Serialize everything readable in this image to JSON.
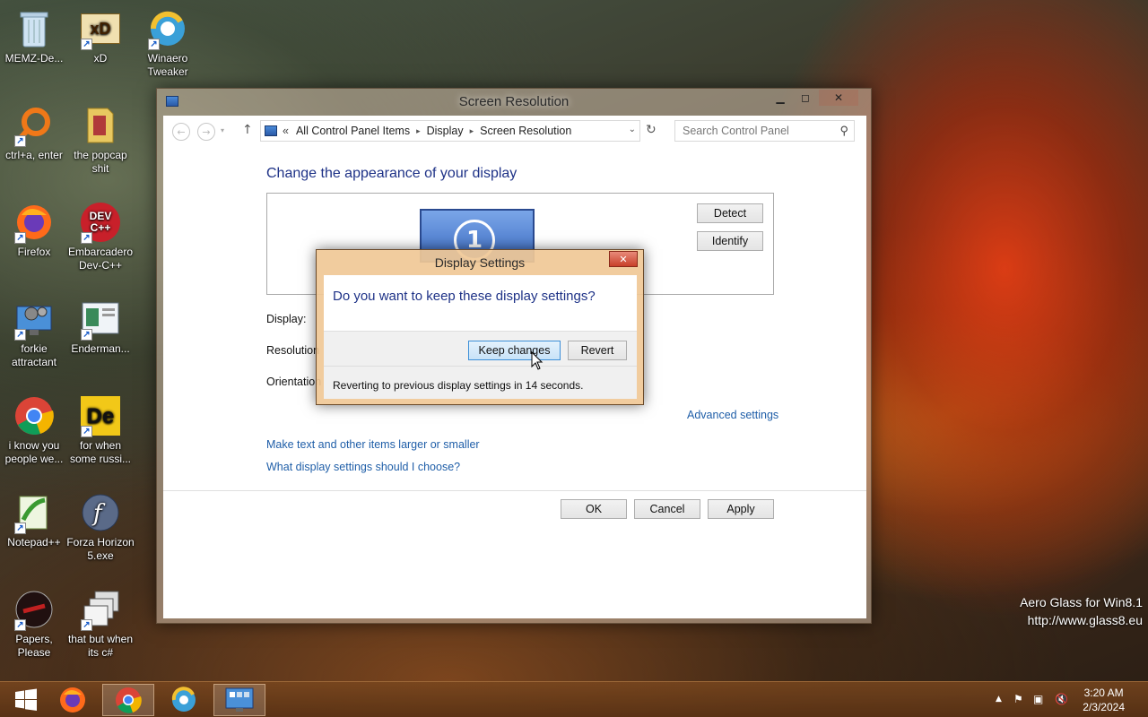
{
  "desktop": {
    "icons": [
      {
        "label": "MEMZ-De..."
      },
      {
        "label": "xD"
      },
      {
        "label": "Winaero Tweaker"
      },
      {
        "label": "ctrl+a, enter"
      },
      {
        "label": "the popcap shit"
      },
      {
        "label": "Firefox"
      },
      {
        "label": "Embarcadero Dev-C++"
      },
      {
        "label": "forkie attractant"
      },
      {
        "label": "Enderman..."
      },
      {
        "label": "i know you people we..."
      },
      {
        "label": "for when some russi..."
      },
      {
        "label": "Notepad++"
      },
      {
        "label": "Forza Horizon 5.exe"
      },
      {
        "label": "Papers, Please"
      },
      {
        "label": "that but when its c#"
      }
    ],
    "icon_glyphs": {
      "dev": "DEV C++",
      "de": "De",
      "xd": "xD"
    }
  },
  "window": {
    "title": "Screen Resolution",
    "breadcrumb": {
      "chevrons": "«",
      "items": [
        "All Control Panel Items",
        "Display",
        "Screen Resolution"
      ],
      "separator": "▸"
    },
    "search_placeholder": "Search Control Panel",
    "heading": "Change the appearance of your display",
    "monitor_number": "1",
    "buttons": {
      "detect": "Detect",
      "identify": "Identify",
      "ok": "OK",
      "cancel": "Cancel",
      "apply": "Apply"
    },
    "labels": {
      "display": "Display:",
      "resolution": "Resolution",
      "orientation": "Orientation"
    },
    "links": {
      "advanced": "Advanced settings",
      "text_size": "Make text and other items larger or smaller",
      "which_settings": "What display settings should I choose?"
    }
  },
  "dialog": {
    "title": "Display Settings",
    "question": "Do you want to keep these display settings?",
    "keep_label": "Keep changes",
    "revert_label": "Revert",
    "message": "Reverting to previous display settings in 14 seconds."
  },
  "watermark": {
    "line1": "Aero Glass for Win8.1",
    "line2": "http://www.glass8.eu"
  },
  "taskbar": {
    "clock_time": "3:20 AM",
    "clock_date": "2/3/2024"
  },
  "colors": {
    "accent": "#1e3287",
    "link": "#1f5ea8",
    "taskbar": "#7a4a20"
  }
}
